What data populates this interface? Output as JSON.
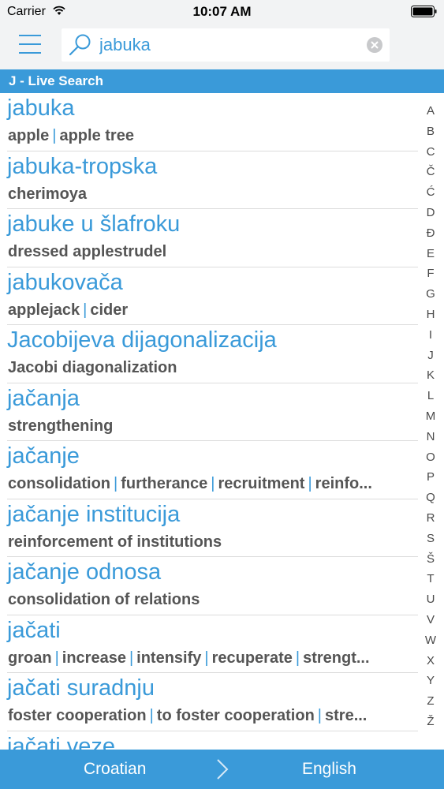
{
  "status": {
    "carrier": "Carrier",
    "time": "10:07 AM"
  },
  "search": {
    "value": "jabuka"
  },
  "section_header": "J - Live Search",
  "entries": [
    {
      "word": "jabuka",
      "translations": [
        "apple",
        "apple tree"
      ]
    },
    {
      "word": "jabuka-tropska",
      "translations": [
        "cherimoya"
      ]
    },
    {
      "word": "jabuke u šlafroku",
      "translations": [
        "dressed applestrudel"
      ]
    },
    {
      "word": "jabukovača",
      "translations": [
        "applejack",
        "cider"
      ]
    },
    {
      "word": "Jacobijeva dijagonalizacija",
      "translations": [
        "Jacobi diagonalization"
      ]
    },
    {
      "word": "jačanja",
      "translations": [
        "strengthening"
      ]
    },
    {
      "word": "jačanje",
      "translations": [
        "consolidation",
        "furtherance",
        "recruitment",
        "reinfo..."
      ]
    },
    {
      "word": "jačanje institucija",
      "translations": [
        "reinforcement of institutions"
      ]
    },
    {
      "word": "jačanje odnosa",
      "translations": [
        "consolidation of relations"
      ]
    },
    {
      "word": "jačati",
      "translations": [
        "groan",
        "increase",
        "intensify",
        "recuperate",
        "strengt..."
      ]
    },
    {
      "word": "jačati suradnju",
      "translations": [
        "foster cooperation",
        "to foster cooperation",
        "stre..."
      ]
    },
    {
      "word": "jačati veze",
      "translations": []
    }
  ],
  "index_letters": [
    "A",
    "B",
    "C",
    "Č",
    "Ć",
    "D",
    "Đ",
    "E",
    "F",
    "G",
    "H",
    "I",
    "J",
    "K",
    "L",
    "M",
    "N",
    "O",
    "P",
    "Q",
    "R",
    "S",
    "Š",
    "T",
    "U",
    "V",
    "W",
    "X",
    "Y",
    "Z",
    "Ž"
  ],
  "footer": {
    "source_language": "Croatian",
    "target_language": "English"
  },
  "colors": {
    "accent": "#3a9ad9",
    "bar_background": "#f2f3f4",
    "translation_text": "#555555"
  },
  "icons": {
    "menu": "hamburger-icon",
    "search": "magnifier-icon",
    "clear": "clear-x-icon",
    "swap": "chevron-right-icon",
    "wifi": "wifi-icon",
    "battery": "battery-icon"
  }
}
